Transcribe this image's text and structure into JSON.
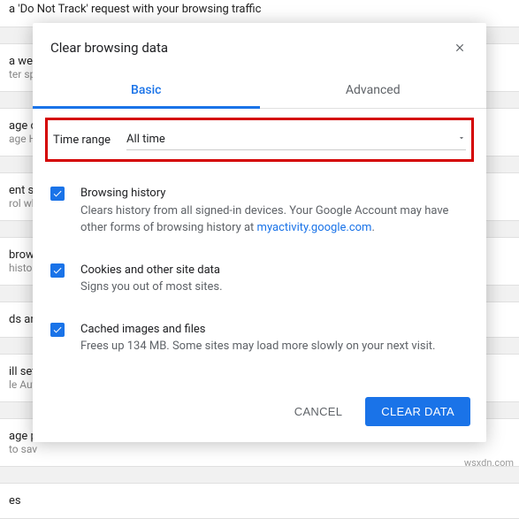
{
  "background": {
    "b0_title": "a 'Do Not Track' request with your browsing traffic",
    "b1_title": "a web s",
    "b1_sub": "ter sp",
    "b2_title": "age ce",
    "b2_sub": "age HT",
    "b3_title": "ent set",
    "b3_sub": "rol wh",
    "b4_title": "brows",
    "b4_sub": "histor",
    "b5_title": "ds and",
    "b6_title": "ill sett",
    "b6_sub": "le Aut",
    "b7_title": "age pa",
    "b7_sub": "to sav",
    "b8_title": "es"
  },
  "dialog": {
    "title": "Clear browsing data",
    "tabs": {
      "basic": "Basic",
      "advanced": "Advanced"
    },
    "time_range": {
      "label": "Time range",
      "value": "All time"
    },
    "options": [
      {
        "title": "Browsing history",
        "desc_a": "Clears history from all signed-in devices. Your Google Account may have other forms of browsing history at ",
        "link": "myactivity.google.com",
        "desc_b": "."
      },
      {
        "title": "Cookies and other site data",
        "desc_a": "Signs you out of most sites."
      },
      {
        "title": "Cached images and files",
        "desc_a": "Frees up 134 MB. Some sites may load more slowly on your next visit."
      }
    ],
    "buttons": {
      "cancel": "CANCEL",
      "confirm": "CLEAR DATA"
    }
  },
  "watermark": "wsxdn.com"
}
